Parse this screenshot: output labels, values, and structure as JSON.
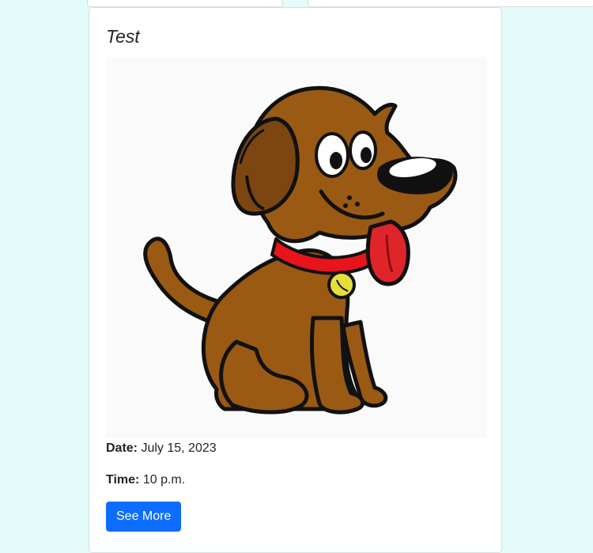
{
  "event": {
    "title": "Test",
    "date_label": "Date:",
    "date_value": "July 15, 2023",
    "time_label": "Time:",
    "time_value": "10 p.m.",
    "see_more_label": "See More"
  },
  "image": {
    "subject": "cartoon-dog-icon"
  },
  "colors": {
    "page_background": "#e3fbf9",
    "card_background": "#ffffff",
    "button": "#0d6efd",
    "dog_fur": "#9a5a14",
    "dog_collar": "#e8141c",
    "dog_tongue": "#e0252a",
    "dog_tag": "#e6de3a"
  }
}
